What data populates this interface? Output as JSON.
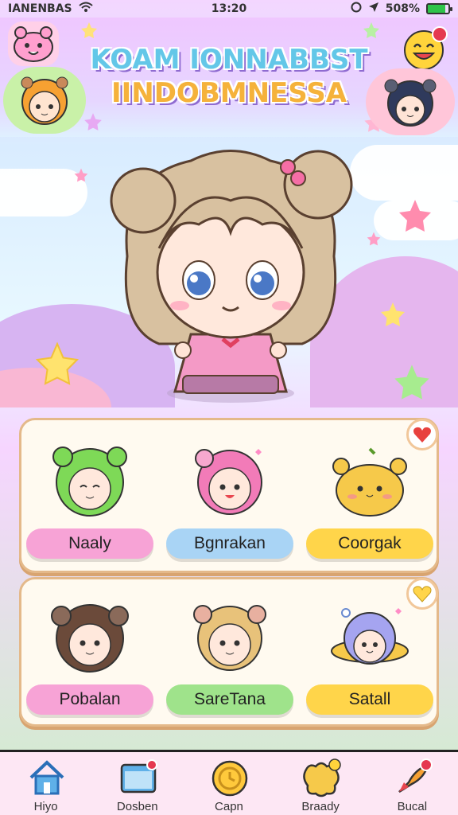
{
  "status": {
    "carrier": "IANENBAS",
    "time": "13:20",
    "battery": "508%",
    "battery_level": 0.85
  },
  "header": {
    "title_line1": "KOAM IONNABBST",
    "title_line2": "IINDOBMNESSA"
  },
  "characters": [
    {
      "name": "Naaly",
      "pill_color": "#f7a3d6",
      "hair": "#7ed957"
    },
    {
      "name": "Bgnrakan",
      "pill_color": "#a9d4f5",
      "hair": "#f27bb8"
    },
    {
      "name": "Coorgak",
      "pill_color": "#ffd54a",
      "hair": "#f6c94a"
    },
    {
      "name": "Pobalan",
      "pill_color": "#f7a3d6",
      "hair": "#6b4a3a"
    },
    {
      "name": "SareTana",
      "pill_color": "#9fe38b",
      "hair": "#e8c27a"
    },
    {
      "name": "Satall",
      "pill_color": "#ffd54a",
      "hair": "#a5a4f0"
    }
  ],
  "nav": [
    {
      "label": "Hiyo",
      "icon": "house-icon"
    },
    {
      "label": "Dosben",
      "icon": "folder-icon"
    },
    {
      "label": "Capn",
      "icon": "coin-icon"
    },
    {
      "label": "Braady",
      "icon": "puzzle-icon"
    },
    {
      "label": "Bucal",
      "icon": "rocket-icon"
    }
  ],
  "colors": {
    "accent_pink": "#ff8fc8",
    "card_border": "#e4b98a",
    "badge_red": "#e53950"
  }
}
